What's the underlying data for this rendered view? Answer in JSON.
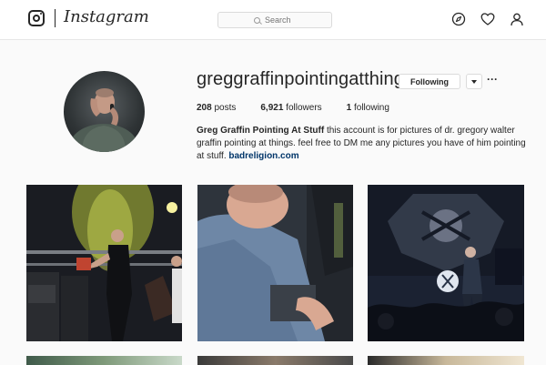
{
  "header": {
    "wordmark": "Instagram",
    "search_placeholder": "Search",
    "nav_icons": [
      "compass-icon",
      "heart-icon",
      "profile-icon"
    ]
  },
  "profile": {
    "username": "greggraffinpointingatthings",
    "follow_label": "Following",
    "more_label": "···",
    "stats": {
      "posts_value": "208",
      "posts_label": " posts",
      "followers_value": "6,921",
      "followers_label": " followers",
      "following_value": "1",
      "following_label": " following"
    },
    "bio": {
      "name": "Greg Graffin Pointing At Stuff",
      "text": " this account is for pictures of dr. gregory walter graffin pointing at things. feel free to DM me any pictures you have of him pointing at stuff. ",
      "link": "badreligion.com"
    }
  },
  "colors": {
    "link": "#003569",
    "text": "#262626",
    "border": "#dbdbdb"
  }
}
